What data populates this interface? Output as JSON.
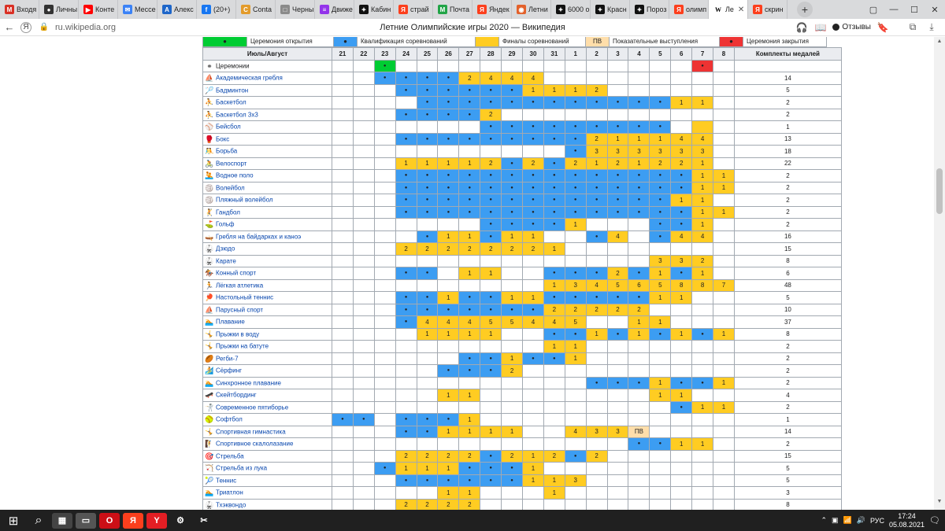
{
  "tabs": [
    {
      "label": "Входя",
      "fav": "М",
      "color": "#d93025"
    },
    {
      "label": "Личны",
      "fav": "●",
      "color": "#333333"
    },
    {
      "label": "Конте",
      "fav": "▶",
      "color": "#ff0000"
    },
    {
      "label": "Мессе",
      "fav": "✉",
      "color": "#3b82f6"
    },
    {
      "label": "Алекс",
      "fav": "A",
      "color": "#1e66c9"
    },
    {
      "label": "(20+)",
      "fav": "f",
      "color": "#1877f2"
    },
    {
      "label": "Conta",
      "fav": "C",
      "color": "#e39b2b"
    },
    {
      "label": "Черны",
      "fav": "□",
      "color": "#8a8a8a"
    },
    {
      "label": "Движе",
      "fav": "≡",
      "color": "#9333ea"
    },
    {
      "label": "Кабин",
      "fav": "✦",
      "color": "#111111"
    },
    {
      "label": "страй",
      "fav": "Я",
      "color": "#fc3f1d"
    },
    {
      "label": "Почта",
      "fav": "M",
      "color": "#22a447"
    },
    {
      "label": "Яндек",
      "fav": "Я",
      "color": "#fc3f1d"
    },
    {
      "label": "Летни",
      "fav": "◉",
      "color": "#e3612b"
    },
    {
      "label": "6000 о",
      "fav": "✦",
      "color": "#111111"
    },
    {
      "label": "Красн",
      "fav": "✦",
      "color": "#111111"
    },
    {
      "label": "Пороз",
      "fav": "✦",
      "color": "#111111"
    },
    {
      "label": "олимп",
      "fav": "Я",
      "color": "#fc3f1d"
    },
    {
      "label": "Ле",
      "fav": "W",
      "color": "#ffffff",
      "active": true
    },
    {
      "label": "скрин",
      "fav": "Я",
      "color": "#fc3f1d"
    }
  ],
  "new_tab": "+",
  "address": {
    "url": "ru.wikipedia.org",
    "page_title": "Летние Олимпийские игры 2020 — Википедия",
    "feedback": "Отзывы"
  },
  "legend": {
    "items": [
      {
        "color": "#00cc33",
        "mark": "●",
        "label": "Церемония открытия"
      },
      {
        "color": "#3c9df2",
        "mark": "●",
        "label": "Квалификация соревнований"
      },
      {
        "color": "#ffcc22",
        "mark": "",
        "label": "Финалы соревнований"
      },
      {
        "color": "#ffdeaa",
        "mark": "ПВ",
        "label": "Показательные выступления"
      },
      {
        "color": "#ee3333",
        "mark": "●",
        "label": "Церемония закрытия"
      }
    ]
  },
  "schedule": {
    "header_label": "Июль/Август",
    "days": [
      "21",
      "22",
      "23",
      "24",
      "25",
      "26",
      "27",
      "28",
      "29",
      "30",
      "31",
      "1",
      "2",
      "3",
      "4",
      "5",
      "6",
      "7",
      "8"
    ],
    "total_header": "Комплекты медалей",
    "rows": [
      {
        "icon": "⚭",
        "name": "Церемонии",
        "cells": "__o______________c",
        "total": ""
      },
      {
        "icon": "⛵",
        "name": "Академическая гребля",
        "cells": "__qqqqFFFF_________",
        "total": "14",
        "finals": {
          "6": "2",
          "7": "4",
          "8": "4",
          "9": "4"
        }
      },
      {
        "icon": "🏸",
        "name": "Бадминтон",
        "cells": "___qqqqqqFFFF______",
        "total": "5",
        "finals": {
          "9": "1",
          "10": "1",
          "11": "1",
          "12": "2"
        }
      },
      {
        "icon": "⛹",
        "name": "Баскетбол",
        "cells": "____qqqqqqqqqqqqFF_",
        "total": "2",
        "finals": {
          "16": "1",
          "17": "1"
        }
      },
      {
        "icon": "⛹",
        "name": "Баскетбол 3x3",
        "cells": "___qqqqF___________",
        "total": "2",
        "finals": {
          "7": "2"
        }
      },
      {
        "icon": "⚾",
        "name": "Бейсбол",
        "cells": "_______qqqqqqqqq_F_",
        "total": "1",
        "finals": {
          "16": "1"
        }
      },
      {
        "icon": "🥊",
        "name": "Бокс",
        "cells": "___qqqqqqqqqFFFFFF_",
        "total": "13",
        "finals": {
          "12": "2",
          "13": "1",
          "14": "1",
          "15": "1",
          "16": "4",
          "17": "4"
        }
      },
      {
        "icon": "🤼",
        "name": "Борьба",
        "cells": "___________qFFFFFF_",
        "total": "18",
        "finals": {
          "12": "3",
          "13": "3",
          "14": "3",
          "15": "3",
          "16": "3",
          "17": "3"
        }
      },
      {
        "icon": "🚴",
        "name": "Велоспорт",
        "cells": "___FFFFFqFqFFFFFFF_",
        "total": "22",
        "finals": {
          "3": "1",
          "4": "1",
          "5": "1",
          "6": "1",
          "7": "2",
          "9": "2",
          "11": "2",
          "12": "1",
          "13": "2",
          "14": "1",
          "15": "2",
          "16": "2",
          "17": "1",
          "18": "3"
        }
      },
      {
        "icon": "🤽",
        "name": "Водное поло",
        "cells": "___qqqqqqqqqqqqqqFF",
        "total": "2",
        "finals": {
          "17": "1",
          "18": "1"
        }
      },
      {
        "icon": "🏐",
        "name": "Волейбол",
        "cells": "___qqqqqqqqqqqqqqFF",
        "total": "2",
        "finals": {
          "17": "1",
          "18": "1"
        }
      },
      {
        "icon": "🏐",
        "name": "Пляжный волейбол",
        "cells": "___qqqqqqqqqqqqqFF_",
        "total": "2",
        "finals": {
          "16": "1",
          "17": "1"
        }
      },
      {
        "icon": "🤾",
        "name": "Гандбол",
        "cells": "___qqqqqqqqqqqqqqFF",
        "total": "2",
        "finals": {
          "17": "1",
          "18": "1"
        }
      },
      {
        "icon": "⛳",
        "name": "Гольф",
        "cells": "_______qqqqF___qqF_",
        "total": "2",
        "finals": {
          "11": "1",
          "17": "1"
        }
      },
      {
        "icon": "🛶",
        "name": "Гребля на байдарках и каноэ",
        "cells": "____qFFqFF__qF_qFF_",
        "total": "16",
        "finals": {
          "5": "1",
          "6": "1",
          "8": "1",
          "9": "1",
          "13": "4",
          "16": "4",
          "17": "4"
        }
      },
      {
        "icon": "🥋",
        "name": "Дзюдо",
        "cells": "___FFFFFFFF________",
        "total": "15",
        "finals": {
          "3": "2",
          "4": "2",
          "5": "2",
          "6": "2",
          "7": "2",
          "8": "2",
          "9": "2",
          "10": "1"
        }
      },
      {
        "icon": "🥋",
        "name": "Карате",
        "cells": "_______________FFF_",
        "total": "8",
        "finals": {
          "15": "3",
          "16": "3",
          "17": "2"
        }
      },
      {
        "icon": "🏇",
        "name": "Конный спорт",
        "cells": "___qq_FF__qqqFqFqF_",
        "total": "6",
        "finals": {
          "6": "1",
          "7": "1",
          "13": "2",
          "15": "1",
          "17": "1"
        }
      },
      {
        "icon": "🏃",
        "name": "Лёгкая атлетика",
        "cells": "__________FFFFFFFFF",
        "total": "48",
        "finals": {
          "10": "1",
          "11": "3",
          "12": "4",
          "13": "5",
          "14": "6",
          "15": "5",
          "16": "8",
          "17": "8",
          "18": "7"
        }
      },
      {
        "icon": "🏓",
        "name": "Настольный теннис",
        "cells": "___qqFqqFFqqqqqFF__",
        "total": "5",
        "finals": {
          "5": "1",
          "8": "1",
          "9": "1",
          "15": "1",
          "16": "1"
        }
      },
      {
        "icon": "⛵",
        "name": "Парусный спорт",
        "cells": "___qqqqqqqFFFFF____",
        "total": "10",
        "finals": {
          "10": "2",
          "11": "2",
          "12": "2",
          "13": "2",
          "14": "2"
        }
      },
      {
        "icon": "🏊",
        "name": "Плавание",
        "cells": "___qFFFFFFFF__FF___",
        "total": "37",
        "finals": {
          "4": "4",
          "5": "4",
          "6": "4",
          "7": "5",
          "8": "5",
          "9": "4",
          "10": "4",
          "11": "5",
          "14": "1",
          "15": "1"
        }
      },
      {
        "icon": "🤸",
        "name": "Прыжки в воду",
        "cells": "____FFFF__qqFqFqFqF",
        "total": "8",
        "finals": {
          "4": "1",
          "5": "1",
          "6": "1",
          "7": "1",
          "12": "1",
          "14": "1",
          "16": "1",
          "18": "1"
        }
      },
      {
        "icon": "🤸",
        "name": "Прыжки на батуте",
        "cells": "__________FF_______",
        "total": "2",
        "finals": {
          "10": "1",
          "11": "1"
        }
      },
      {
        "icon": "🏉",
        "name": "Регби-7",
        "cells": "______qqFqqF_______",
        "total": "2",
        "finals": {
          "8": "1",
          "11": "1"
        }
      },
      {
        "icon": "🏄",
        "name": "Сёрфинг",
        "cells": "_____qqqF__________",
        "total": "2",
        "finals": {
          "8": "2"
        }
      },
      {
        "icon": "🏊",
        "name": "Синхронное плавание",
        "cells": "____________qqqFqqF",
        "total": "2",
        "finals": {
          "15": "1",
          "18": "1"
        }
      },
      {
        "icon": "🛹",
        "name": "Скейтбординг",
        "cells": "_____FF________FF__",
        "total": "4",
        "finals": {
          "5": "1",
          "6": "1",
          "15": "1",
          "16": "1"
        }
      },
      {
        "icon": "🤺",
        "name": "Современное пятиборье",
        "cells": "________________qFF",
        "total": "2",
        "finals": {
          "17": "1",
          "18": "1"
        }
      },
      {
        "icon": "🥎",
        "name": "Софтбол",
        "cells": "qq_qqqF____________",
        "total": "1",
        "finals": {
          "6": "1"
        }
      },
      {
        "icon": "🤸",
        "name": "Спортивная гимнастика",
        "cells": "___qqFFFF__FFFE____",
        "total": "14",
        "finals": {
          "5": "1",
          "6": "1",
          "7": "1",
          "8": "1",
          "11": "4",
          "12": "3",
          "13": "3"
        },
        "exhibition": {
          "14": "ПВ"
        }
      },
      {
        "icon": "🧗",
        "name": "Спортивное скалолазание",
        "cells": "______________qqFF_",
        "total": "2",
        "finals": {
          "16": "1",
          "17": "1"
        }
      },
      {
        "icon": "🎯",
        "name": "Стрельба",
        "cells": "___FFFFqFFFqF______",
        "total": "15",
        "finals": {
          "3": "2",
          "4": "2",
          "5": "2",
          "6": "2",
          "8": "2",
          "9": "1",
          "10": "2",
          "12": "2"
        }
      },
      {
        "icon": "🏹",
        "name": "Стрельба из лука",
        "cells": "__qFFFqqqF_________",
        "total": "5",
        "finals": {
          "3": "1",
          "4": "1",
          "5": "1",
          "9": "1",
          "10": "1"
        }
      },
      {
        "icon": "🎾",
        "name": "Теннис",
        "cells": "___qqqqqqFFF_______",
        "total": "5",
        "finals": {
          "9": "1",
          "10": "1",
          "11": "3"
        }
      },
      {
        "icon": "🏊",
        "name": "Триатлон",
        "cells": "_____FF___F________",
        "total": "3",
        "finals": {
          "5": "1",
          "6": "1",
          "10": "1"
        }
      },
      {
        "icon": "🥋",
        "name": "Тхэквондо",
        "cells": "___FFFF____________",
        "total": "8",
        "finals": {
          "3": "2",
          "4": "2",
          "5": "2",
          "6": "2"
        }
      }
    ]
  },
  "taskbar": {
    "start": "⊞",
    "search": "⌕",
    "apps": [
      {
        "label": "▦",
        "color": "#444444"
      },
      {
        "label": "▭",
        "color": "#555555"
      },
      {
        "label": "O",
        "color": "#cc0f16"
      },
      {
        "label": "Я",
        "color": "#fc3f1d"
      },
      {
        "label": "Y",
        "color": "#e31e24"
      },
      {
        "label": "⚙",
        "color": "#202020"
      },
      {
        "label": "✂",
        "color": "#202020"
      }
    ],
    "tray_lang": "РУС",
    "time": "17:24",
    "date": "05.08.2021"
  }
}
